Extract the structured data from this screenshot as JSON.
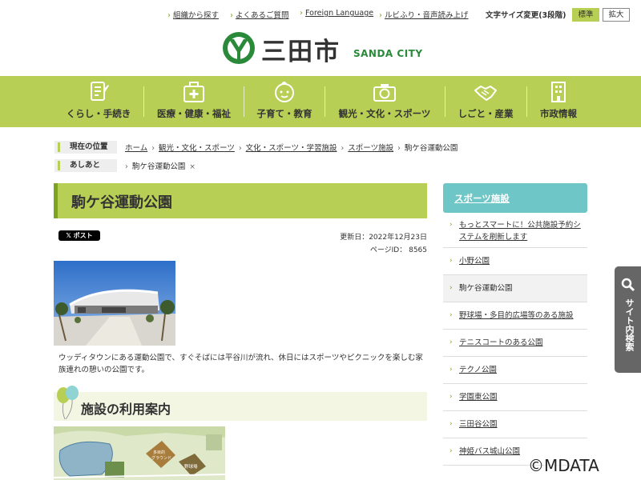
{
  "util": {
    "links": [
      "組織から探す",
      "よくあるご質問",
      "Foreign Language",
      "ルビふり・音声読み上げ"
    ],
    "font_size_label": "文字サイズ変更(3段階)",
    "font_std": "標準",
    "font_large": "拡大"
  },
  "logo": {
    "name": "三田市",
    "en": "SANDA CITY"
  },
  "gnav": [
    {
      "label": "くらし・手続き",
      "icon": "document-icon"
    },
    {
      "label": "医療・健康・福祉",
      "icon": "medical-kit-icon"
    },
    {
      "label": "子育て・教育",
      "icon": "baby-face-icon"
    },
    {
      "label": "観光・文化・スポーツ",
      "icon": "camera-icon"
    },
    {
      "label": "しごと・産業",
      "icon": "handshake-icon"
    },
    {
      "label": "市政情報",
      "icon": "building-icon"
    }
  ],
  "breadcrumb": {
    "current_label": "現在の位置",
    "links": [
      "ホーム",
      "観光・文化・スポーツ",
      "文化・スポーツ・学習施設",
      "スポーツ施設"
    ],
    "current": "駒ケ谷運動公園",
    "history_label": "あしあと",
    "history_item": "駒ケ谷運動公園",
    "history_close": "×"
  },
  "page": {
    "title": "駒ケ谷運動公園",
    "post_label": "𝕏 ポスト",
    "updated": "更新日：2022年12月23日",
    "page_id": "ページID： 8565",
    "description": "ウッディタウンにある運動公園で、すぐそばには平谷川が流れ、休日にはスポーツやピクニックを楽しむ家族連れの憩いの公園です。",
    "section_title": "施設の利用案内",
    "map_labels": {
      "plaza": "多目的グラウンド",
      "baseball": "野球場"
    }
  },
  "sidebar": {
    "heading": "スポーツ施設",
    "items": [
      "もっとスマートに！公共施設予約システムを刷新します",
      "小野公園",
      "駒ケ谷運動公園",
      "野球場・多目的広場等のある施設",
      "テニスコートのある公園",
      "テクノ公園",
      "学園東公園",
      "三田谷公園",
      "神姫バス城山公園"
    ],
    "current_index": 2
  },
  "search_tab": {
    "label": "サイト内検索"
  },
  "copyright": "©MDATA",
  "colors": {
    "accent_green": "#b7cf54",
    "dark_green": "#7aa51d",
    "teal": "#6fc6c6",
    "logo_green": "#2a8a3a"
  }
}
